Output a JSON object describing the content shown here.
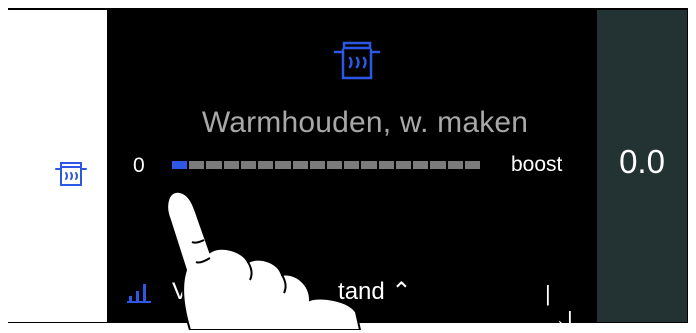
{
  "main": {
    "title": "Warmhouden, w. maken",
    "slider": {
      "min_label": "0",
      "max_label": "boost",
      "segments": 18,
      "active_segments": 1,
      "level_fraction": 0.0556
    },
    "bottom": {
      "label_prefix": "Ve",
      "label_suffix": "tand ⌃",
      "next_label": "|→|"
    }
  },
  "right_panel": {
    "value": "0.0"
  },
  "icons": {
    "pot": "pot-steam-icon",
    "bars": "signal-bars-icon",
    "next": "skip-next-icon"
  },
  "colors": {
    "accent": "#2f57e5",
    "text_gray": "#a8a8a8",
    "right_bg": "#233233",
    "inactive_segment": "#7b7b7b"
  }
}
